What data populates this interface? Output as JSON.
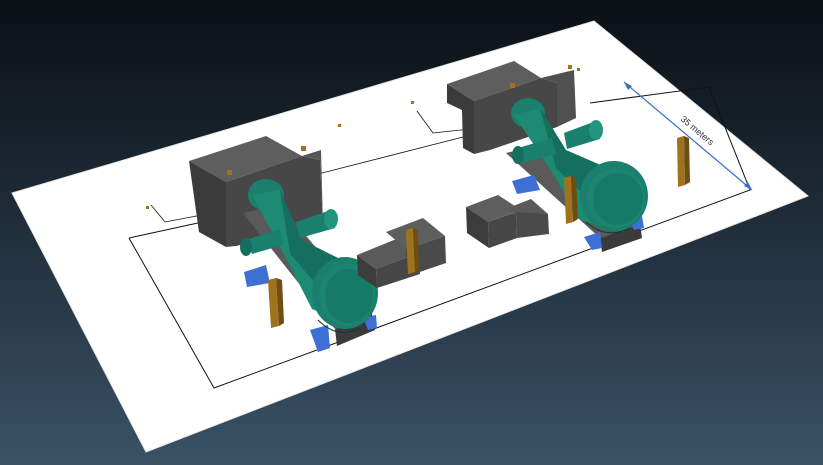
{
  "scene": {
    "title": "",
    "dimension_label": "35 meters",
    "colors": {
      "background_top": "#0b1015",
      "background_bottom": "#3a5266",
      "ground": "#ffffff",
      "plinth": "#4a4a4a",
      "horn": "#1a7f6c",
      "post": "#a0721c",
      "shadow_plate": "#3d6fd4",
      "dimension_line": "#3b6fc4",
      "outline": "#111111"
    },
    "objects": {
      "left_unit": {
        "plinth_icon": "plinth-block",
        "horn_icon": "horn-instrument"
      },
      "right_unit": {
        "plinth_icon": "plinth-block",
        "horn_icon": "horn-instrument"
      },
      "middle_blocks": {
        "icon": "stepped-block"
      },
      "markers": {
        "icon": "small-marker"
      }
    }
  }
}
